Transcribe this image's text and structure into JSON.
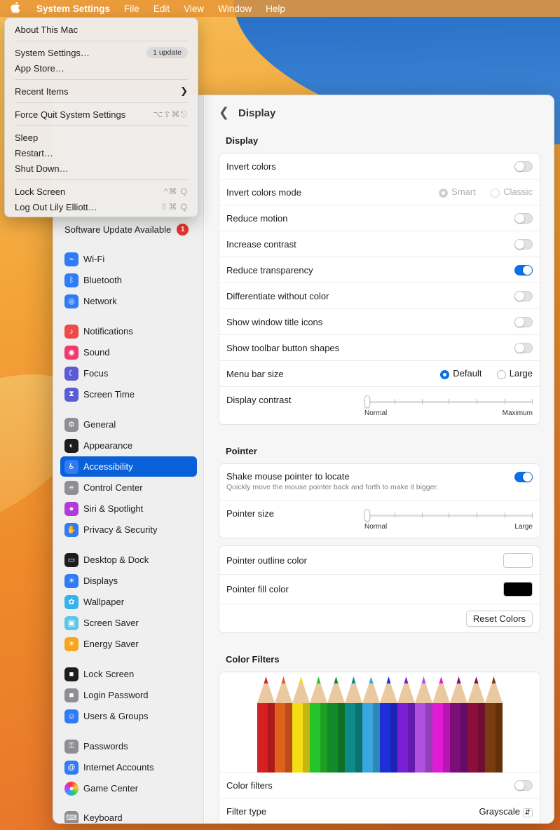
{
  "menubar": {
    "app_name": "System Settings",
    "items": [
      "File",
      "Edit",
      "View",
      "Window",
      "Help"
    ]
  },
  "apple_menu": {
    "about": "About This Mac",
    "system_settings": "System Settings…",
    "update_badge": "1 update",
    "app_store": "App Store…",
    "recent_items": "Recent Items",
    "force_quit": "Force Quit System Settings",
    "force_quit_shortcut": "⌥⇧⌘⎋",
    "sleep": "Sleep",
    "restart": "Restart…",
    "shut_down": "Shut Down…",
    "lock_screen": "Lock Screen",
    "lock_screen_shortcut": "^⌘ Q",
    "log_out": "Log Out Lily Elliott…",
    "log_out_shortcut": "⇧⌘ Q"
  },
  "sidebar": {
    "update_label": "Software Update Available",
    "update_count": "1",
    "items": [
      {
        "label": "Wi-Fi",
        "icon": "wifi-icon",
        "color": "#2f7cf6"
      },
      {
        "label": "Bluetooth",
        "icon": "bluetooth-icon",
        "color": "#2f7cf6"
      },
      {
        "label": "Network",
        "icon": "globe-icon",
        "color": "#2f7cf6"
      },
      {
        "label": "Notifications",
        "icon": "bell-icon",
        "color": "#ee4a47"
      },
      {
        "label": "Sound",
        "icon": "speaker-icon",
        "color": "#ee3b6f"
      },
      {
        "label": "Focus",
        "icon": "moon-icon",
        "color": "#5b5bd6"
      },
      {
        "label": "Screen Time",
        "icon": "hourglass-icon",
        "color": "#5b5bd6"
      },
      {
        "label": "General",
        "icon": "gear-icon",
        "color": "#8e8e93"
      },
      {
        "label": "Appearance",
        "icon": "appearance-icon",
        "color": "#1d1d1f"
      },
      {
        "label": "Accessibility",
        "icon": "accessibility-icon",
        "color": "#2f7cf6"
      },
      {
        "label": "Control Center",
        "icon": "control-center-icon",
        "color": "#8e8e93"
      },
      {
        "label": "Siri & Spotlight",
        "icon": "siri-icon",
        "color": "#b03bd6"
      },
      {
        "label": "Privacy & Security",
        "icon": "hand-icon",
        "color": "#2f7cf6"
      },
      {
        "label": "Desktop & Dock",
        "icon": "dock-icon",
        "color": "#1d1d1f"
      },
      {
        "label": "Displays",
        "icon": "sun-icon",
        "color": "#2f7cf6"
      },
      {
        "label": "Wallpaper",
        "icon": "flower-icon",
        "color": "#35b3ea"
      },
      {
        "label": "Screen Saver",
        "icon": "screensaver-icon",
        "color": "#5ac8e8"
      },
      {
        "label": "Energy Saver",
        "icon": "bulb-icon",
        "color": "#f7a51e"
      },
      {
        "label": "Lock Screen",
        "icon": "lock-icon",
        "color": "#1d1d1f"
      },
      {
        "label": "Login Password",
        "icon": "lock-icon",
        "color": "#8e8e93"
      },
      {
        "label": "Users & Groups",
        "icon": "users-icon",
        "color": "#2f7cf6"
      },
      {
        "label": "Passwords",
        "icon": "key-icon",
        "color": "#8e8e93"
      },
      {
        "label": "Internet Accounts",
        "icon": "at-icon",
        "color": "#2f7cf6"
      },
      {
        "label": "Game Center",
        "icon": "game-center-icon",
        "color": "#f4f4f4"
      },
      {
        "label": "Keyboard",
        "icon": "keyboard-icon",
        "color": "#8e8e93"
      }
    ],
    "selected": "Accessibility"
  },
  "content": {
    "title": "Display",
    "display_section": "Display",
    "rows": {
      "invert_colors": "Invert colors",
      "invert_colors_mode": "Invert colors mode",
      "smart": "Smart",
      "classic": "Classic",
      "reduce_motion": "Reduce motion",
      "increase_contrast": "Increase contrast",
      "reduce_transparency": "Reduce transparency",
      "differentiate": "Differentiate without color",
      "window_title_icons": "Show window title icons",
      "toolbar_shapes": "Show toolbar button shapes",
      "menu_bar_size": "Menu bar size",
      "default": "Default",
      "large": "Large",
      "display_contrast": "Display contrast",
      "contrast_min": "Normal",
      "contrast_max": "Maximum"
    },
    "pointer_section": "Pointer",
    "pointer": {
      "shake": "Shake mouse pointer to locate",
      "shake_sub": "Quickly move the mouse pointer back and forth to make it bigger.",
      "pointer_size": "Pointer size",
      "size_min": "Normal",
      "size_max": "Large",
      "outline_color": "Pointer outline color",
      "fill_color": "Pointer fill color",
      "reset": "Reset Colors"
    },
    "color_filters_section": "Color Filters",
    "color_filters": "Color filters",
    "filter_type": "Filter type",
    "filter_value": "Grayscale"
  },
  "toggles": {
    "invert_colors": false,
    "reduce_motion": false,
    "increase_contrast": false,
    "reduce_transparency": true,
    "differentiate": false,
    "window_title_icons": false,
    "toolbar_shapes": false,
    "shake": true,
    "color_filters": false
  },
  "pencil_colors": [
    "#d42020",
    "#e0611c",
    "#f3dd14",
    "#25c42a",
    "#12892c",
    "#0f8a8a",
    "#3aa5de",
    "#1e2fd9",
    "#7a1fd6",
    "#b14fe0",
    "#e21bd8",
    "#7a0f7a",
    "#8a0f3d",
    "#7a3c0e"
  ]
}
